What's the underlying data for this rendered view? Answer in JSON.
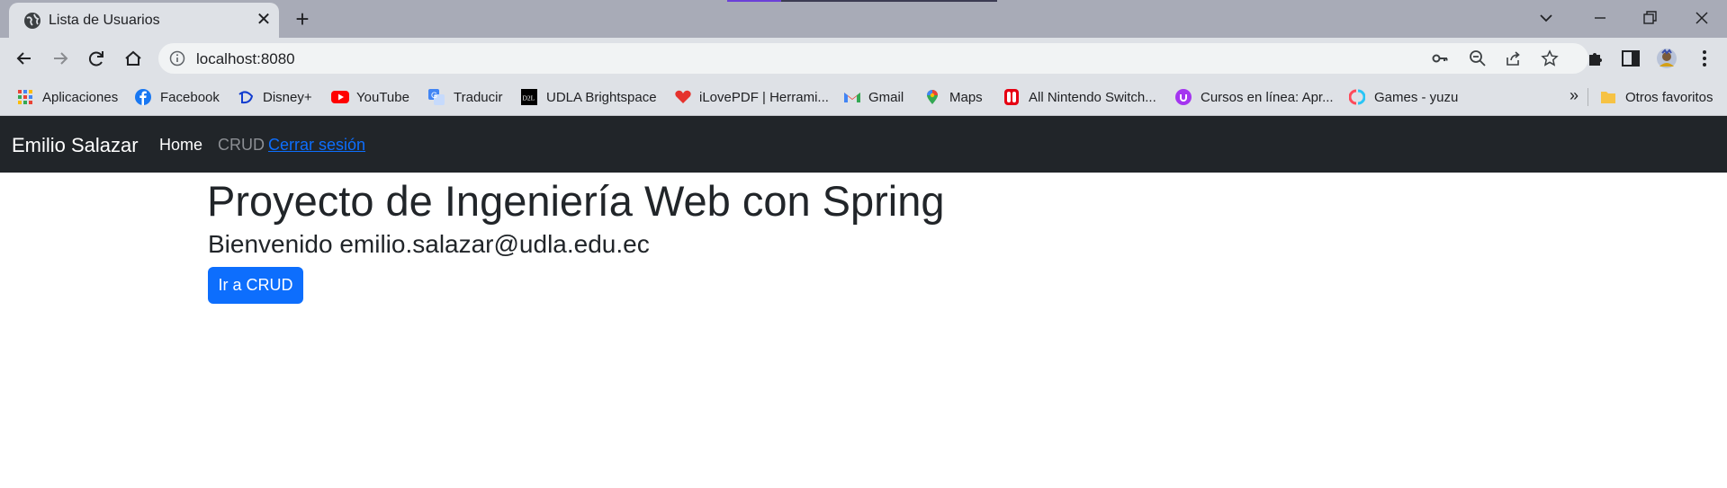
{
  "browser": {
    "tab": {
      "title": "Lista de Usuarios",
      "favicon": "globe-icon"
    },
    "new_tab_label": "+",
    "url": "localhost:8080",
    "bookmarks": [
      {
        "label": "Aplicaciones",
        "icon": "apps-grid-icon"
      },
      {
        "label": "Facebook",
        "icon": "facebook-icon"
      },
      {
        "label": "Disney+",
        "icon": "disney-icon"
      },
      {
        "label": "YouTube",
        "icon": "youtube-icon"
      },
      {
        "label": "Traducir",
        "icon": "translate-icon"
      },
      {
        "label": "UDLA Brightspace",
        "icon": "d2l-icon"
      },
      {
        "label": "iLovePDF | Herrami...",
        "icon": "ilovepdf-icon"
      },
      {
        "label": "Gmail",
        "icon": "gmail-icon"
      },
      {
        "label": "Maps",
        "icon": "maps-icon"
      },
      {
        "label": "All Nintendo Switch...",
        "icon": "nintendo-switch-icon"
      },
      {
        "label": "Cursos en línea: Apr...",
        "icon": "udemy-icon"
      },
      {
        "label": "Games - yuzu",
        "icon": "yuzu-icon"
      }
    ],
    "bookmarks_overflow": "»",
    "other_bookmarks": "Otros favoritos"
  },
  "page": {
    "navbar": {
      "brand": "Emilio Salazar",
      "links": {
        "home": "Home",
        "crud": "CRUD",
        "logout": "Cerrar sesión"
      }
    },
    "title": "Proyecto de Ingeniería Web con Spring",
    "welcome": "Bienvenido emilio.salazar@udla.edu.ec",
    "crud_button": "Ir a CRUD"
  },
  "colors": {
    "navbar_bg": "#212529",
    "primary": "#0d6efd",
    "muted_link": "#8c8f94",
    "tabstrip_bg": "#a8abb7",
    "toolbar_bg": "#dee1e6"
  }
}
